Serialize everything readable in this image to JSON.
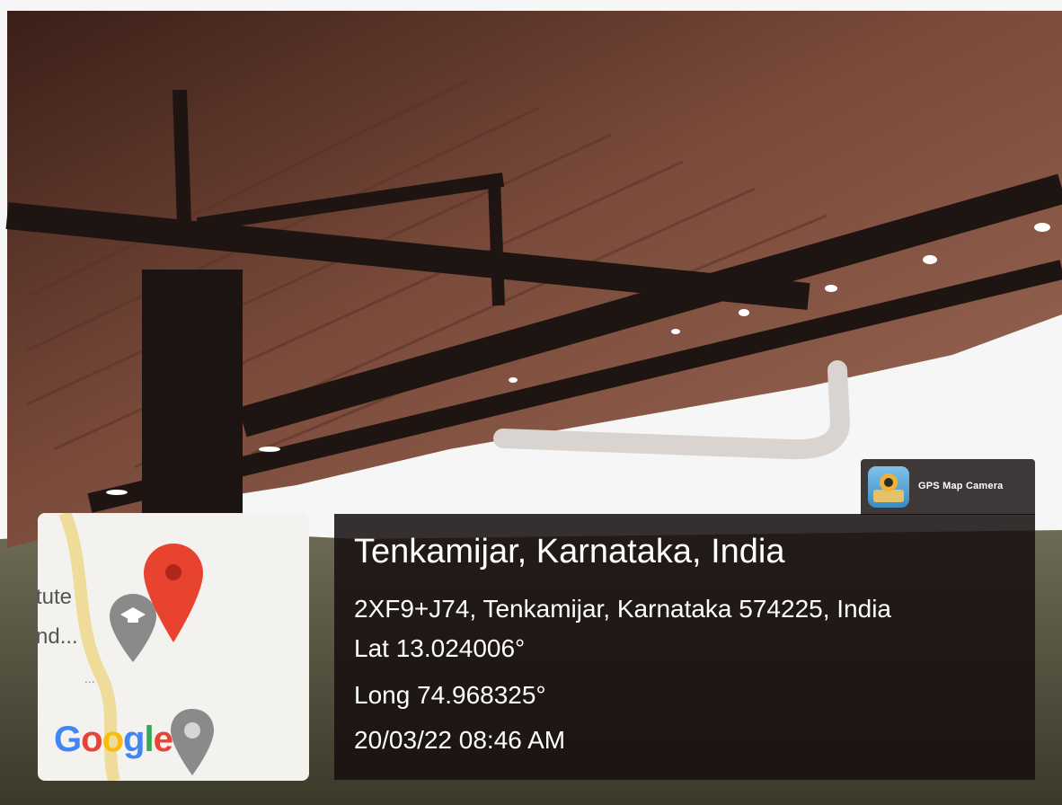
{
  "badge": {
    "app_name": "GPS Map Camera",
    "icon": "gps-map-camera-app-icon"
  },
  "overlay": {
    "place": "Tenkamijar, Karnataka, India",
    "address": "2XF9+J74, Tenkamijar, Karnataka 574225, India",
    "latitude": "Lat 13.024006°",
    "longitude": "Long 74.968325°",
    "datetime": "20/03/22 08:46 AM"
  },
  "map": {
    "labels": [
      "tute",
      "nd...",
      "..."
    ],
    "logo": [
      "G",
      "o",
      "o",
      "g",
      "l",
      "e"
    ],
    "logo_colors": [
      "#4285F4",
      "#EA4335",
      "#FBBC05",
      "#4285F4",
      "#34A853",
      "#EA4335"
    ],
    "pin_icons": [
      "red-location-pin-icon",
      "education-place-pin-icon",
      "gray-place-pin-icon"
    ]
  },
  "colors": {
    "overlay_bg": "#160e0e",
    "red_pin": "#e8432e",
    "gray_pin": "#8a8a8a",
    "roof": "#8a5a48",
    "sky": "#f6f6f6"
  }
}
